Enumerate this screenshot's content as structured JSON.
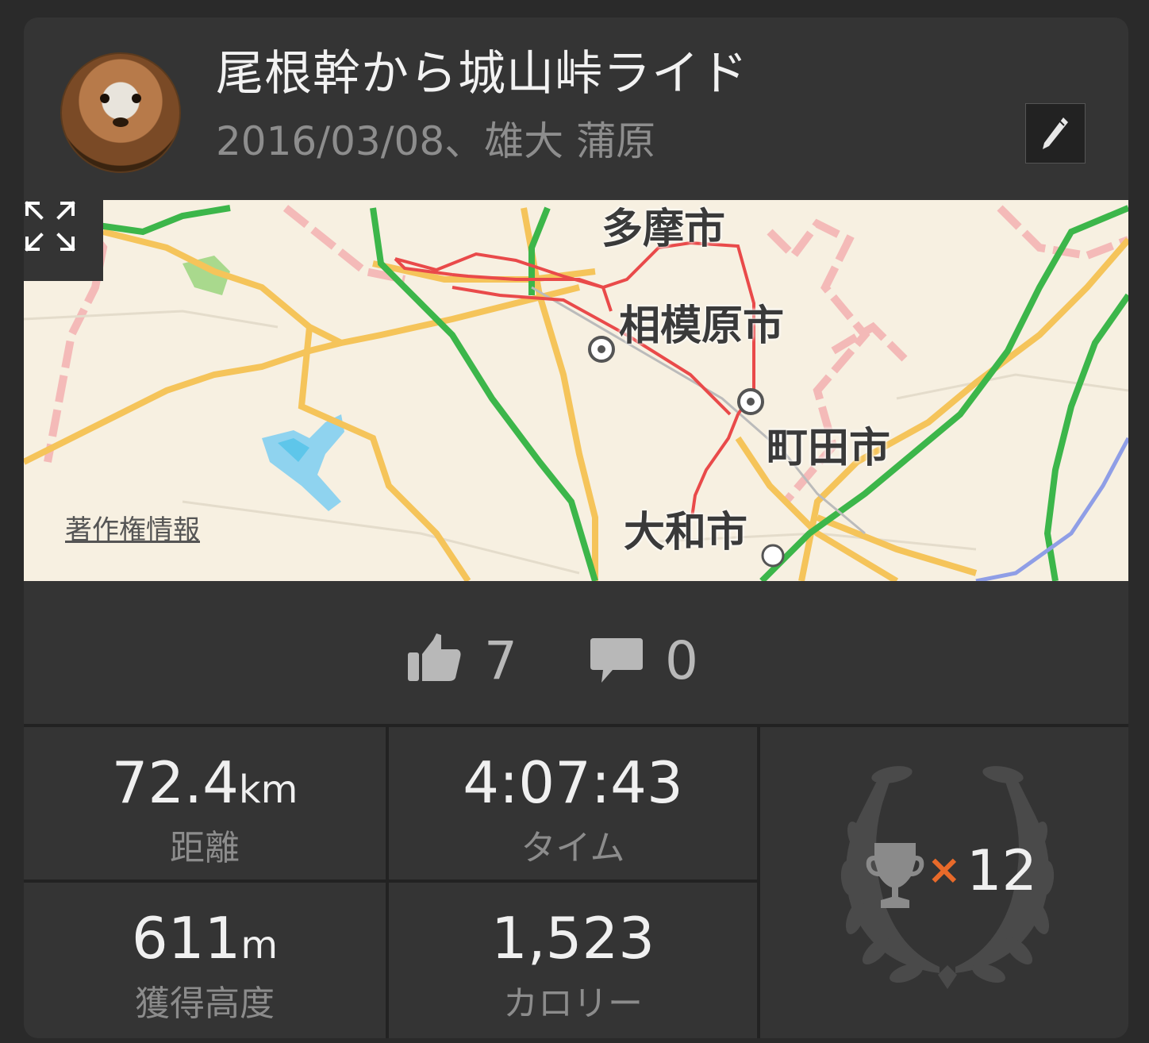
{
  "activity": {
    "title": "尾根幹から城山峠ライド",
    "subtitle": "2016/03/08、雄大 蒲原"
  },
  "map": {
    "labels": [
      "多摩市",
      "相模原市",
      "町田市",
      "大和市"
    ],
    "copyright": "著作権情報",
    "colors": {
      "route": "#e94a4a",
      "highway": "#3cb64a",
      "road": "#f5c45a",
      "water": "#5ec6ea",
      "boundary": "#f3b0b0"
    }
  },
  "social": {
    "likes": "7",
    "comments": "0"
  },
  "stats": {
    "distance": {
      "value": "72.4",
      "unit": "km",
      "label": "距離"
    },
    "time": {
      "value": "4:07:43",
      "label": "タイム"
    },
    "elevation": {
      "value": "611",
      "unit": "m",
      "label": "獲得高度"
    },
    "calories": {
      "value": "1,523",
      "label": "カロリー"
    },
    "achievements": {
      "times": "×",
      "count": "12"
    }
  },
  "icons": [
    "avatar",
    "pencil-icon",
    "expand-icon",
    "thumbs-up-icon",
    "comment-icon",
    "trophy-icon",
    "laurel-wreath-icon"
  ]
}
